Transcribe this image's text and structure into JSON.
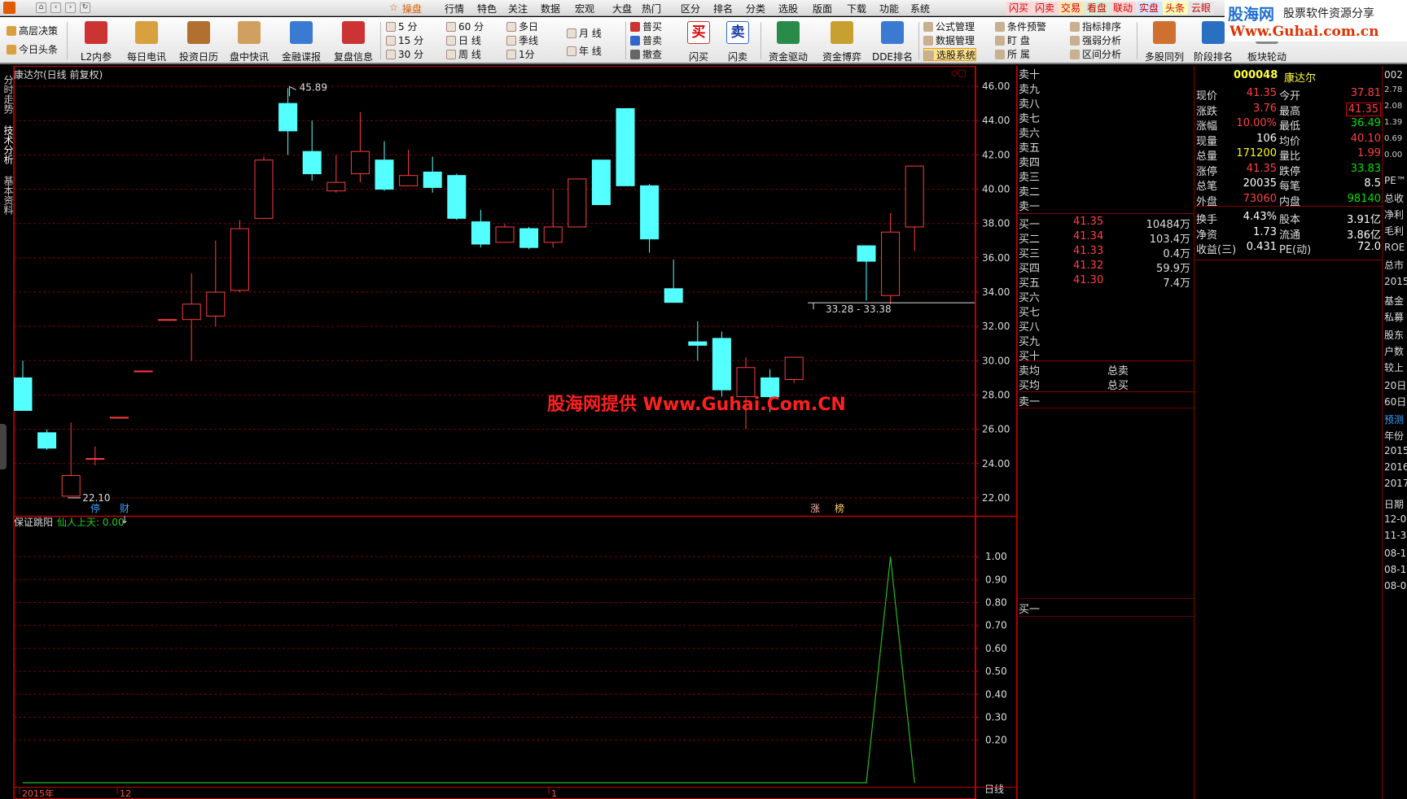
{
  "menubar": {
    "items": [
      "操盘",
      "行情",
      "特色",
      "关注",
      "数据",
      "宏观",
      "大盘",
      "热门",
      "区分",
      "排名",
      "分类",
      "选股",
      "版面",
      "下载",
      "功能",
      "系统"
    ],
    "tags": [
      "闪买",
      "闪卖",
      "交易",
      "看盘",
      "联动",
      "实盘",
      "头条",
      "云眼"
    ],
    "tag_colors": [
      "#ffd6d6",
      "#ffd6d6",
      "#ffe6b3",
      "#d6f0d6",
      "#ffd6d6",
      "#d6e6ff",
      "#ffffb3",
      "#e6e6e6"
    ],
    "brand": "股海网",
    "brand_sub": "股票软件资源分享",
    "brand_url": "Www.Guhai.com.cn"
  },
  "toolbar": {
    "left_links": [
      "高层决策",
      "今日头条"
    ],
    "buttons": [
      {
        "label": "L2内参",
        "icon": "arrow-up-icon",
        "color": "#c33"
      },
      {
        "label": "每日电讯",
        "icon": "notepad-icon",
        "color": "#d9a040"
      },
      {
        "label": "投资日历",
        "icon": "printer-icon",
        "color": "#b07030"
      },
      {
        "label": "盘中快讯",
        "icon": "clipboard-icon",
        "color": "#d0a060"
      },
      {
        "label": "金融谍报",
        "icon": "chart-icon",
        "color": "#3a7ad0"
      },
      {
        "label": "复盘信息",
        "icon": "arrow-up-icon",
        "color": "#c33"
      }
    ],
    "periods": [
      [
        "5 分",
        "15 分",
        "30 分"
      ],
      [
        "60 分",
        "日 线",
        "周 线"
      ],
      [
        "多日",
        "季线",
        "1分"
      ],
      [
        "月 线",
        "年 线"
      ]
    ],
    "trade_links": [
      "普买",
      "普卖",
      "撤查"
    ],
    "buy_label": "闪买",
    "sell_label": "闪卖",
    "buttons2": [
      {
        "label": "资金驱动",
        "icon": "down-arrow-icon",
        "color": "#2a8a4a"
      },
      {
        "label": "资金博弈",
        "icon": "coins-icon",
        "color": "#c8a030"
      },
      {
        "label": "DDE排名",
        "icon": "bar-chart-icon",
        "color": "#3a7ad0"
      }
    ],
    "links_col1": [
      "公式管理",
      "数据管理",
      "选股系统"
    ],
    "links_col2": [
      "条件预警",
      "盯 盘",
      "所 属"
    ],
    "links_col3": [
      "指标排序",
      "强弱分析",
      "区间分析"
    ],
    "buttons3": [
      {
        "label": "多股同列",
        "icon": "wave-icon",
        "color": "#d07030"
      },
      {
        "label": "阶段排名",
        "icon": "globe-icon",
        "color": "#2a70c0"
      },
      {
        "label": "板块轮动",
        "icon": "grid-icon",
        "color": "#888"
      }
    ]
  },
  "sidetabs": [
    "分时走势",
    "技术分析",
    "基本资料"
  ],
  "chart": {
    "title": "康达尔(日线 前复权)",
    "indicator_name": "保证跳阳",
    "indicator_line": "仙人上天: 0.00",
    "watermark": "股海网提供 Www.Guhai.Com.CN",
    "period_label": "日线",
    "high_label": "45.89",
    "low_label": "22.10",
    "range_label": "33.28 - 33.38",
    "event_marks": [
      "停",
      "财",
      "涨",
      "榜"
    ],
    "x_labels": [
      "2015年",
      "12",
      "1"
    ]
  },
  "chart_data": [
    {
      "type": "candlestick",
      "title": "康达尔(日线 前复权)",
      "ylim": [
        21,
        47
      ],
      "yticks": [
        22.0,
        24.0,
        26.0,
        28.0,
        30.0,
        32.0,
        34.0,
        36.0,
        38.0,
        40.0,
        42.0,
        44.0,
        46.0
      ],
      "candles": [
        {
          "o": 29.0,
          "h": 30.0,
          "l": 27.1,
          "c": 27.1
        },
        {
          "o": 25.8,
          "h": 26.0,
          "l": 24.8,
          "c": 24.9
        },
        {
          "o": 22.1,
          "h": 26.4,
          "l": 22.1,
          "c": 23.3
        },
        {
          "o": 24.3,
          "h": 25.0,
          "l": 23.9,
          "c": 24.3
        },
        {
          "o": 26.7,
          "h": 26.7,
          "l": 26.7,
          "c": 26.7
        },
        {
          "o": 29.4,
          "h": 29.4,
          "l": 29.4,
          "c": 29.4
        },
        {
          "o": 32.4,
          "h": 32.4,
          "l": 32.4,
          "c": 32.4
        },
        {
          "o": 32.4,
          "h": 35.1,
          "l": 30.0,
          "c": 33.3
        },
        {
          "o": 32.6,
          "h": 37.0,
          "l": 32.0,
          "c": 34.0
        },
        {
          "o": 34.1,
          "h": 38.2,
          "l": 34.0,
          "c": 37.7
        },
        {
          "o": 38.3,
          "h": 41.9,
          "l": 38.3,
          "c": 41.7
        },
        {
          "o": 45.0,
          "h": 45.89,
          "l": 42.0,
          "c": 43.4
        },
        {
          "o": 42.2,
          "h": 44.0,
          "l": 40.5,
          "c": 40.9
        },
        {
          "o": 39.9,
          "h": 42.0,
          "l": 39.8,
          "c": 40.4
        },
        {
          "o": 40.9,
          "h": 44.5,
          "l": 40.4,
          "c": 42.2
        },
        {
          "o": 41.7,
          "h": 42.8,
          "l": 39.9,
          "c": 40.0
        },
        {
          "o": 40.2,
          "h": 42.3,
          "l": 40.2,
          "c": 40.8
        },
        {
          "o": 41.0,
          "h": 41.9,
          "l": 39.8,
          "c": 40.1
        },
        {
          "o": 40.8,
          "h": 40.9,
          "l": 38.2,
          "c": 38.3
        },
        {
          "o": 38.1,
          "h": 38.8,
          "l": 36.6,
          "c": 36.8
        },
        {
          "o": 36.9,
          "h": 38.0,
          "l": 36.9,
          "c": 37.8
        },
        {
          "o": 37.7,
          "h": 37.8,
          "l": 36.5,
          "c": 36.6
        },
        {
          "o": 36.9,
          "h": 40.0,
          "l": 36.6,
          "c": 37.8
        },
        {
          "o": 37.8,
          "h": 40.6,
          "l": 37.8,
          "c": 40.6
        },
        {
          "o": 41.7,
          "h": 41.7,
          "l": 39.1,
          "c": 39.1
        },
        {
          "o": 44.7,
          "h": 44.7,
          "l": 40.2,
          "c": 40.2
        },
        {
          "o": 40.2,
          "h": 40.3,
          "l": 36.3,
          "c": 37.1
        },
        {
          "o": 34.2,
          "h": 35.9,
          "l": 33.5,
          "c": 33.4
        },
        {
          "o": 31.1,
          "h": 32.3,
          "l": 30.0,
          "c": 30.9
        },
        {
          "o": 31.3,
          "h": 31.7,
          "l": 27.9,
          "c": 28.3
        },
        {
          "o": 27.9,
          "h": 30.2,
          "l": 26.0,
          "c": 29.6
        },
        {
          "o": 29.0,
          "h": 29.5,
          "l": 27.0,
          "c": 27.9
        },
        {
          "o": 28.9,
          "h": 29.8,
          "l": 28.7,
          "c": 30.2
        },
        {
          "o": 0,
          "h": 0,
          "l": 0,
          "c": 0,
          "skip": true
        },
        {
          "o": 0,
          "h": 0,
          "l": 0,
          "c": 0,
          "skip": true
        },
        {
          "o": 36.7,
          "h": 36.7,
          "l": 33.5,
          "c": 35.8
        },
        {
          "o": 33.8,
          "h": 38.6,
          "l": 33.3,
          "c": 37.5
        },
        {
          "o": 37.8,
          "h": 41.35,
          "l": 36.4,
          "c": 41.35
        }
      ]
    },
    {
      "type": "line",
      "title": "保证跳阳",
      "series": [
        {
          "name": "仙人上天",
          "values": [
            0,
            0,
            0,
            0,
            0,
            0,
            0,
            0,
            0,
            0,
            0,
            0,
            0,
            0,
            0,
            0,
            0,
            0,
            0,
            0,
            0,
            0,
            0,
            0,
            0,
            0,
            0,
            0,
            0,
            0,
            0,
            0,
            0,
            0,
            0,
            0,
            1,
            0
          ]
        }
      ],
      "ylim": [
        0,
        1.1
      ],
      "yticks": [
        0.2,
        0.3,
        0.4,
        0.5,
        0.6,
        0.7,
        0.8,
        0.9,
        1.0
      ]
    }
  ],
  "book": {
    "sells": [
      "卖十",
      "卖九",
      "卖八",
      "卖七",
      "卖六",
      "卖五",
      "卖四",
      "卖三",
      "卖二",
      "卖一"
    ],
    "buys": [
      {
        "label": "买一",
        "price": "41.35",
        "vol": "10484万"
      },
      {
        "label": "买二",
        "price": "41.34",
        "vol": "103.4万"
      },
      {
        "label": "买三",
        "price": "41.33",
        "vol": "0.4万"
      },
      {
        "label": "买四",
        "price": "41.32",
        "vol": "59.9万"
      },
      {
        "label": "买五",
        "price": "41.30",
        "vol": "7.4万"
      },
      {
        "label": "买六",
        "price": "",
        "vol": ""
      },
      {
        "label": "买七",
        "price": "",
        "vol": ""
      },
      {
        "label": "买八",
        "price": "",
        "vol": ""
      },
      {
        "label": "买九",
        "price": "",
        "vol": ""
      },
      {
        "label": "买十",
        "price": "",
        "vol": ""
      }
    ],
    "sell_avg": "卖均",
    "buy_avg": "买均",
    "total_sell": "总卖",
    "total_buy": "总买",
    "trade_row": "卖一",
    "trade_row2": "买一"
  },
  "quote": {
    "code": "000048",
    "name": "康达尔",
    "rows": [
      {
        "l1": "现价",
        "v1": "41.35",
        "c1": "#ff4040",
        "l2": "今开",
        "v2": "37.81",
        "c2": "#ff4040"
      },
      {
        "l1": "涨跌",
        "v1": "3.76",
        "c1": "#ff4040",
        "l2": "最高",
        "v2": "41.35",
        "c2": "#ff4040"
      },
      {
        "l1": "涨幅",
        "v1": "10.00%",
        "c1": "#ff4040",
        "l2": "最低",
        "v2": "36.49",
        "c2": "#00e000"
      },
      {
        "l1": "现量",
        "v1": "106",
        "c1": "#ffffff",
        "l2": "均价",
        "v2": "40.10",
        "c2": "#ff4040"
      },
      {
        "l1": "总量",
        "v1": "171200",
        "c1": "#ffff00",
        "l2": "量比",
        "v2": "1.99",
        "c2": "#ff4040"
      },
      {
        "l1": "涨停",
        "v1": "41.35",
        "c1": "#ff4040",
        "l2": "跌停",
        "v2": "33.83",
        "c2": "#00e000"
      },
      {
        "l1": "总笔",
        "v1": "20035",
        "c1": "#ffffff",
        "l2": "每笔",
        "v2": "8.5",
        "c2": "#ffffff"
      },
      {
        "l1": "外盘",
        "v1": "73060",
        "c1": "#ff4040",
        "l2": "内盘",
        "v2": "98140",
        "c2": "#00e000"
      },
      {
        "l1": "换手",
        "v1": "4.43%",
        "c1": "#ffffff",
        "l2": "股本",
        "v2": "3.91亿",
        "c2": "#ffffff"
      },
      {
        "l1": "净资",
        "v1": "1.73",
        "c1": "#ffffff",
        "l2": "流通",
        "v2": "3.86亿",
        "c2": "#ffffff"
      },
      {
        "l1": "收益(三)",
        "v1": "0.431",
        "c1": "#ffffff",
        "l2": "PE(动)",
        "v2": "72.0",
        "c2": "#ffffff"
      }
    ]
  },
  "rstrip": {
    "items": [
      "002",
      "2.78",
      "2.08",
      "1.39",
      "0.69",
      "0.00",
      "PE™",
      "总收",
      "净利",
      "毛利",
      "ROE",
      "总市",
      "2015",
      "基金",
      "私募",
      "股东",
      "户数",
      "较上",
      "20日",
      "60日",
      "预测",
      "年份",
      "2015",
      "2016",
      "2017",
      "日期",
      "12-0",
      "11-3",
      "08-1",
      "08-1",
      "08-0"
    ]
  },
  "colors": {
    "up": "#ff3c3c",
    "down": "#54ffff",
    "grid": "#7a0000",
    "axis": "#c00000",
    "indicator_line": "#22bb22"
  }
}
